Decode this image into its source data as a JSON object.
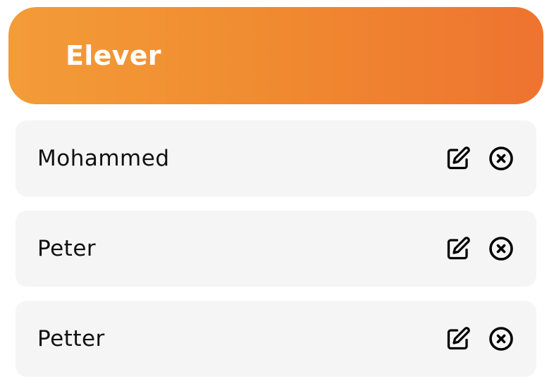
{
  "header": {
    "title": "Elever"
  },
  "students": [
    {
      "name": "Mohammed",
      "edit_icon": "edit-icon",
      "delete_icon": "x-circle-icon"
    },
    {
      "name": "Peter",
      "edit_icon": "edit-icon",
      "delete_icon": "x-circle-icon"
    },
    {
      "name": "Petter",
      "edit_icon": "edit-icon",
      "delete_icon": "x-circle-icon"
    }
  ],
  "colors": {
    "header_gradient_start": "#f39c38",
    "header_gradient_end": "#ee7330",
    "row_background": "#f5f5f5",
    "header_text": "#ffffff",
    "row_text": "#111111"
  }
}
